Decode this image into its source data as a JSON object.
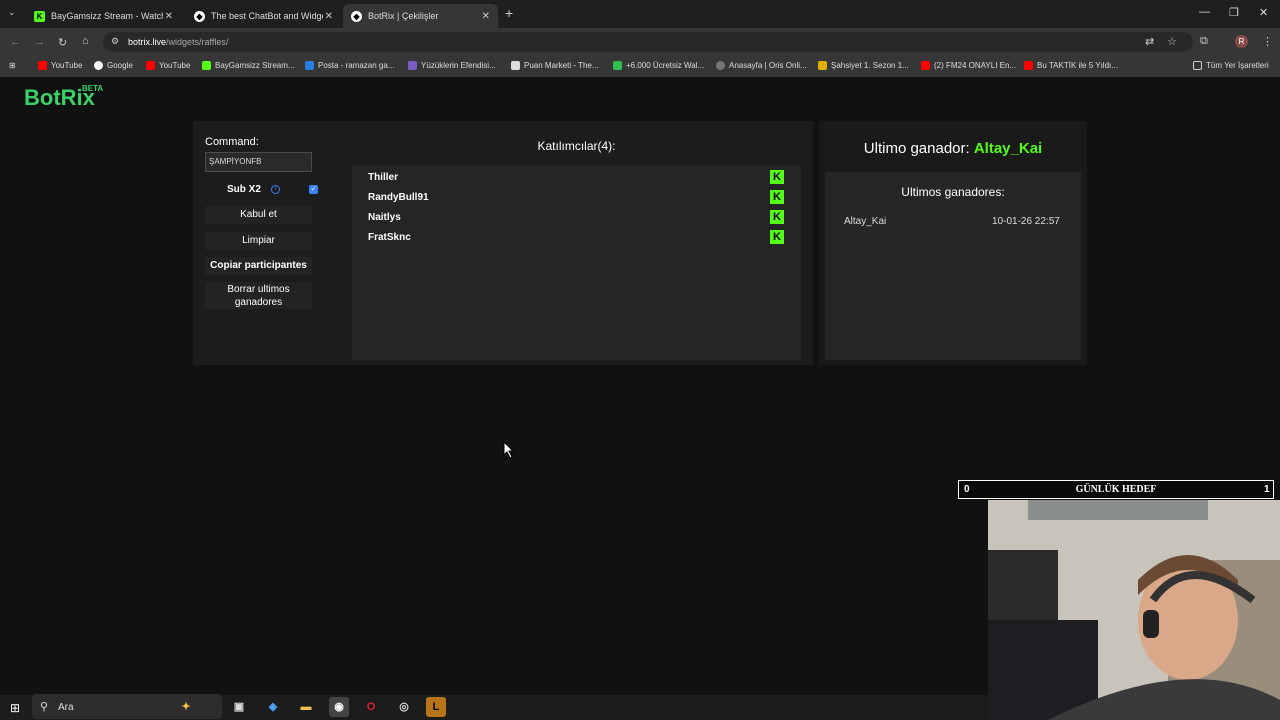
{
  "browser": {
    "tabs": [
      {
        "title": "BayGamsizz Stream - Watch Live",
        "favicon": "kick-icon"
      },
      {
        "title": "The best ChatBot and Widgets",
        "favicon": "botrix-icon"
      },
      {
        "title": "BotRix | Çekilişler",
        "favicon": "botrix-icon"
      }
    ],
    "url_host": "botrix.live",
    "url_path": "/widgets/raffles/",
    "profile_initial": "R"
  },
  "bookmarks": [
    "YouTube",
    "Google",
    "YouTube",
    "BayGamsizz Stream...",
    "Posta - ramazan ga...",
    "Yüzüklerin Efendisi...",
    "Puan Marketi - The...",
    "+6.000 Ücretsiz Wal...",
    "Anasayfa | Oris Onli...",
    "Şahsiyet 1. Sezon 1...",
    "(2) FM24 ONAYLI En...",
    "Bu TAKTİK ile 5 Yıldı..."
  ],
  "bookmarks_all": "Tüm Yer İşaretleri",
  "app": {
    "logo": "BotRix",
    "beta": "BETA"
  },
  "controls": {
    "command_label": "Command:",
    "command_value": "ŞAMPİYONFB",
    "sub_label": "Sub X2",
    "sub_checked": true,
    "accept": "Kabul et",
    "clear": "Limpiar",
    "copy": "Copiar participantes",
    "delete_winners": "Borrar ultimos ganadores"
  },
  "participants": {
    "title": "Katılımcılar(4):",
    "list": [
      "Thiller",
      "RandyBull91",
      "Naitlys",
      "FratSknc"
    ]
  },
  "winner": {
    "label": "Ultimo ganador:",
    "name": "Altay_Kai",
    "history_title": "Ultimos ganadores:",
    "history": [
      {
        "name": "Altay_Kai",
        "date": "10-01-26 22:57"
      }
    ]
  },
  "goal": {
    "left": "0",
    "title": "GÜNLÜK HEDEF",
    "right": "1"
  },
  "taskbar": {
    "search": "Ara"
  },
  "colors": {
    "accent": "#53fc18",
    "logo": "#3bd16a",
    "checkbox": "#3b82f6"
  }
}
